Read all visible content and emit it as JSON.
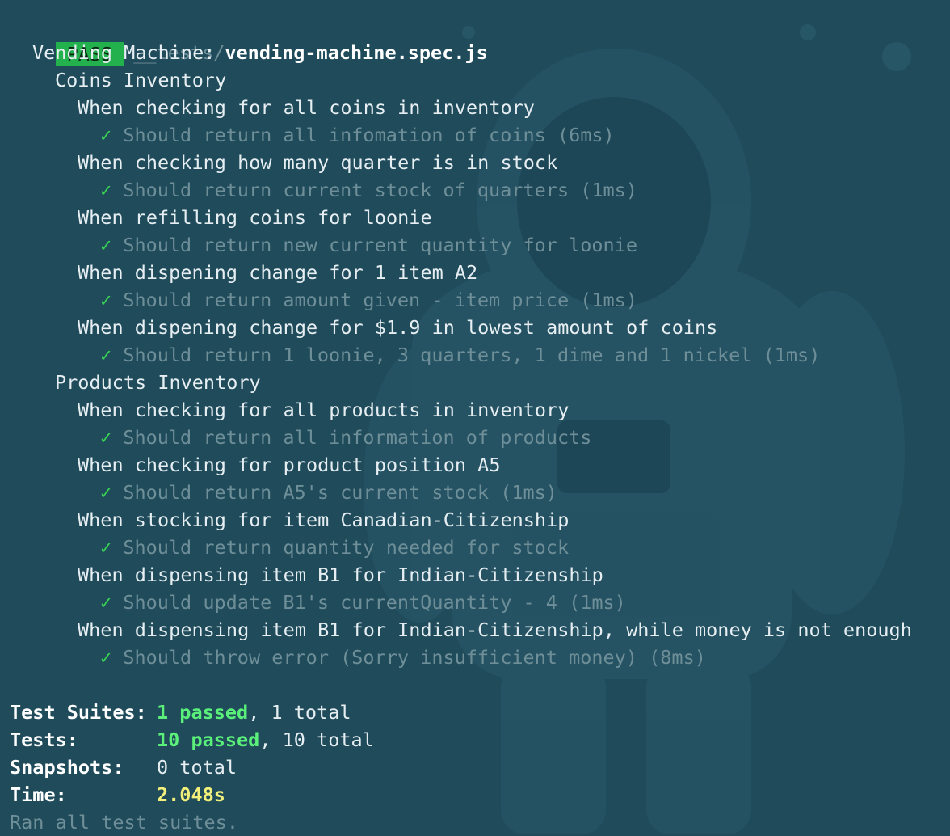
{
  "header": {
    "badge": "PASS",
    "path_dir": "__tests/",
    "path_file": "vending-machine.spec.js"
  },
  "suite": {
    "title": "Vending Machine:",
    "groups": [
      {
        "title": "Coins Inventory",
        "cases": [
          {
            "when": "When checking for all coins in inventory",
            "should": "Should return all infomation of coins (6ms)"
          },
          {
            "when": "When checking how many quarter is in stock",
            "should": "Should return current stock of quarters (1ms)"
          },
          {
            "when": "When refilling coins for loonie",
            "should": "Should return new current quantity for loonie"
          },
          {
            "when": "When dispening change for 1 item A2",
            "should": "Should return amount given - item price (1ms)"
          },
          {
            "when": "When dispening change for $1.9 in lowest amount of coins",
            "should": "Should return 1 loonie, 3 quarters, 1 dime and 1 nickel (1ms)"
          }
        ]
      },
      {
        "title": "Products Inventory",
        "cases": [
          {
            "when": "When checking for all products in inventory",
            "should": "Should return all information of products"
          },
          {
            "when": "When checking for product position A5",
            "should": "Should return A5's current stock (1ms)"
          },
          {
            "when": "When stocking for item Canadian-Citizenship",
            "should": "Should return quantity needed for stock"
          },
          {
            "when": "When dispensing item B1 for Indian-Citizenship",
            "should": "Should update B1's currentQuantity - 4 (1ms)"
          },
          {
            "when": "When dispensing item B1 for Indian-Citizenship, while money is not enough",
            "should": "Should throw error (Sorry insufficient money) (8ms)"
          }
        ]
      }
    ],
    "check_mark": "✓"
  },
  "summary": {
    "suites_label": "Test Suites:",
    "suites_passed": "1 passed",
    "suites_total": ", 1 total",
    "tests_label": "Tests:",
    "tests_passed": "10 passed",
    "tests_total": ", 10 total",
    "snapshots_label": "Snapshots:",
    "snapshots_value": "0 total",
    "time_label": "Time:",
    "time_value": "2.048s",
    "footer": "Ran all test suites."
  },
  "colors": {
    "background": "#1f4b5b",
    "pass_badge": "#22b14c",
    "check": "#39d353",
    "dim_text": "#6e8e98",
    "passed_text": "#5af07a",
    "time_text": "#f2f07a"
  }
}
